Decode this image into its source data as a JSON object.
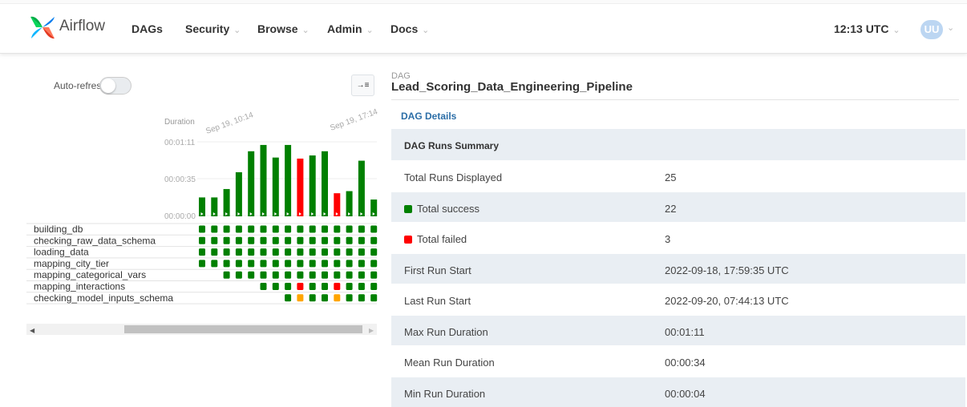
{
  "nav": {
    "brand": "Airflow",
    "items": [
      {
        "label": "DAGs",
        "caret": ""
      },
      {
        "label": "Security",
        "caret": "⌄"
      },
      {
        "label": "Browse",
        "caret": "⌄"
      },
      {
        "label": "Admin",
        "caret": "⌄"
      },
      {
        "label": "Docs",
        "caret": "⌄"
      }
    ],
    "time": "12:13 UTC",
    "time_caret": "⌄",
    "user": "UU",
    "user_caret": "⌄"
  },
  "grid": {
    "auto_refresh_label": "Auto-refresh",
    "auto_refresh_on": false,
    "expand_icon": "→≡",
    "duration_label": "Duration",
    "date_start": "Sep 19, 10:14",
    "date_end": "Sep 19, 17:14",
    "y_ticks": [
      "00:01:11",
      "00:00:35",
      "00:00:00"
    ],
    "runs": [
      {
        "duration_sec": 18,
        "state": "success"
      },
      {
        "duration_sec": 18,
        "state": "success"
      },
      {
        "duration_sec": 26,
        "state": "success"
      },
      {
        "duration_sec": 42,
        "state": "success"
      },
      {
        "duration_sec": 62,
        "state": "success"
      },
      {
        "duration_sec": 68,
        "state": "success"
      },
      {
        "duration_sec": 56,
        "state": "success"
      },
      {
        "duration_sec": 68,
        "state": "success"
      },
      {
        "duration_sec": 55,
        "state": "failed"
      },
      {
        "duration_sec": 58,
        "state": "success"
      },
      {
        "duration_sec": 62,
        "state": "success"
      },
      {
        "duration_sec": 22,
        "state": "failed"
      },
      {
        "duration_sec": 24,
        "state": "success"
      },
      {
        "duration_sec": 53,
        "state": "success"
      },
      {
        "duration_sec": 16,
        "state": "success"
      }
    ],
    "tasks": [
      {
        "name": "building_db",
        "states": [
          "success",
          "success",
          "success",
          "success",
          "success",
          "success",
          "success",
          "success",
          "success",
          "success",
          "success",
          "success",
          "success",
          "success",
          "success"
        ]
      },
      {
        "name": "checking_raw_data_schema",
        "states": [
          "success",
          "success",
          "success",
          "success",
          "success",
          "success",
          "success",
          "success",
          "success",
          "success",
          "success",
          "success",
          "success",
          "success",
          "success"
        ]
      },
      {
        "name": "loading_data",
        "states": [
          "success",
          "success",
          "success",
          "success",
          "success",
          "success",
          "success",
          "success",
          "success",
          "success",
          "success",
          "success",
          "success",
          "success",
          "success"
        ]
      },
      {
        "name": "mapping_city_tier",
        "states": [
          "success",
          "success",
          "success",
          "success",
          "success",
          "success",
          "success",
          "success",
          "success",
          "success",
          "success",
          "success",
          "success",
          "success",
          "success"
        ]
      },
      {
        "name": "mapping_categorical_vars",
        "states": [
          "none",
          "none",
          "success",
          "success",
          "success",
          "success",
          "success",
          "success",
          "success",
          "success",
          "success",
          "success",
          "success",
          "success",
          "success"
        ]
      },
      {
        "name": "mapping_interactions",
        "states": [
          "none",
          "none",
          "none",
          "none",
          "none",
          "success",
          "success",
          "success",
          "failed",
          "success",
          "success",
          "failed",
          "success",
          "success",
          "success"
        ]
      },
      {
        "name": "checking_model_inputs_schema",
        "states": [
          "none",
          "none",
          "none",
          "none",
          "none",
          "none",
          "none",
          "success",
          "upstream_failed",
          "success",
          "success",
          "upstream_failed",
          "success",
          "success",
          "success"
        ]
      }
    ],
    "scroll_left": "◀",
    "scroll_right": "▶"
  },
  "details": {
    "dag_label": "DAG",
    "dag_name": "Lead_Scoring_Data_Engineering_Pipeline",
    "tab": "DAG Details",
    "summary_header": "DAG Runs Summary",
    "rows": [
      {
        "key": "Total Runs Displayed",
        "value": "25",
        "marker": ""
      },
      {
        "key": "Total success",
        "value": "22",
        "marker": "success"
      },
      {
        "key": "Total failed",
        "value": "3",
        "marker": "failed"
      },
      {
        "key": "First Run Start",
        "value": "2022-09-18, 17:59:35 UTC",
        "marker": ""
      },
      {
        "key": "Last Run Start",
        "value": "2022-09-20, 07:44:13 UTC",
        "marker": ""
      },
      {
        "key": "Max Run Duration",
        "value": "00:01:11",
        "marker": ""
      },
      {
        "key": "Mean Run Duration",
        "value": "00:00:34",
        "marker": ""
      },
      {
        "key": "Min Run Duration",
        "value": "00:00:04",
        "marker": ""
      }
    ]
  },
  "colors": {
    "success": "#008000",
    "failed": "#ff0000",
    "upstream_failed": "#ffa500",
    "accent": "#2c6ea7"
  }
}
